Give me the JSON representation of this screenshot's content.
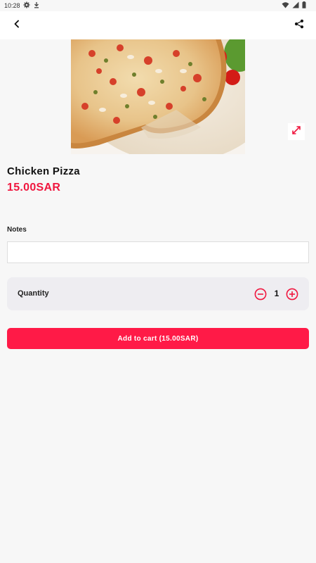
{
  "status_bar": {
    "time": "10:28",
    "icons_left": [
      "gear-icon",
      "download-icon"
    ],
    "icons_right": [
      "wifi-icon",
      "signal-icon",
      "battery-icon"
    ]
  },
  "app_bar": {
    "back_icon": "chevron-left-icon",
    "share_icon": "share-icon"
  },
  "product": {
    "image_description": "pizza",
    "name": "Chicken Pizza",
    "price": "15.00SAR"
  },
  "notes": {
    "label": "Notes",
    "value": "",
    "placeholder": ""
  },
  "quantity": {
    "label": "Quantity",
    "value": "1"
  },
  "cart_button": {
    "label": "Add to cart (15.00SAR)"
  },
  "colors": {
    "accent": "#ff1a47",
    "price": "#f0173f",
    "background": "#f7f7f7",
    "quantity_bg": "#eeedf1"
  }
}
